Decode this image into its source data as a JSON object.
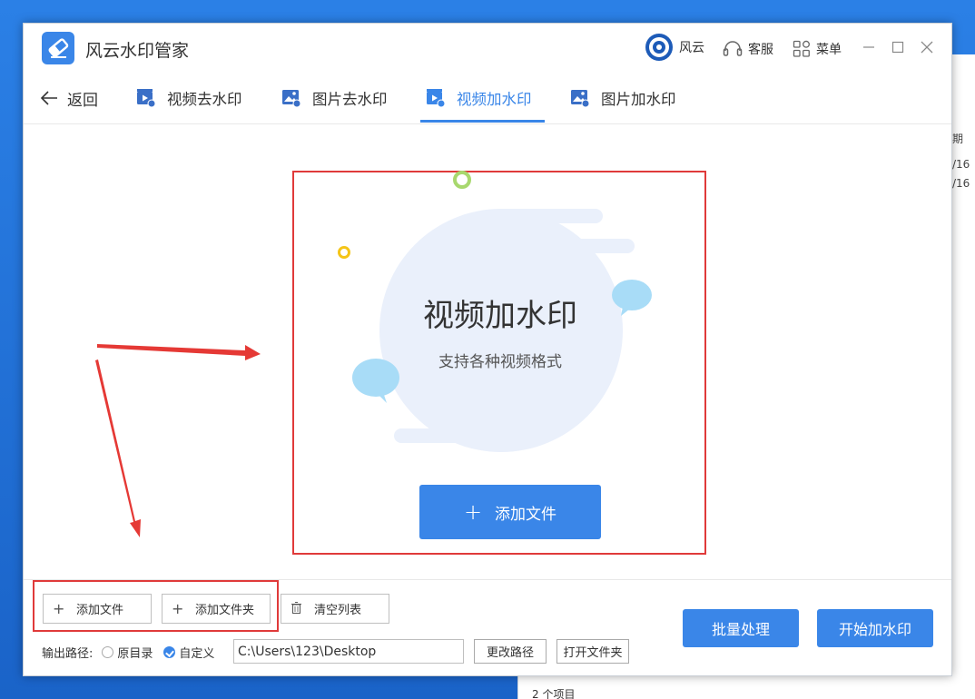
{
  "app": {
    "title": "风云水印管家",
    "top_bar": {
      "account_label": "风云",
      "service_label": "客服",
      "menu_label": "菜单"
    },
    "window_controls": {
      "minimize": "—",
      "maximize": "☐",
      "close": "✕"
    }
  },
  "nav": {
    "back_label": "返回",
    "tabs": [
      {
        "label": "视频去水印",
        "icon": "video-icon",
        "active": false
      },
      {
        "label": "图片去水印",
        "icon": "image-icon",
        "active": false
      },
      {
        "label": "视频加水印",
        "icon": "video-icon",
        "active": true
      },
      {
        "label": "图片加水印",
        "icon": "image-icon",
        "active": false
      }
    ]
  },
  "drop_area": {
    "title": "视频加水印",
    "subtitle": "支持各种视频格式",
    "add_button": "添加文件"
  },
  "bottom": {
    "add_file": "添加文件",
    "add_folder": "添加文件夹",
    "clear_list": "清空列表",
    "output_label": "输出路径:",
    "option_original": "原目录",
    "option_custom": "自定义",
    "path_value": "C:\\Users\\123\\Desktop",
    "change_path": "更改路径",
    "open_folder": "打开文件夹",
    "batch": "批量处理",
    "start": "开始加水印"
  },
  "background_window": {
    "col_header_fragment": "期",
    "date_fragment_1": "/16",
    "date_fragment_2": "/16",
    "status": "2 个项目"
  },
  "colors": {
    "accent": "#3a86e8",
    "highlight_red": "#e03a3a"
  }
}
